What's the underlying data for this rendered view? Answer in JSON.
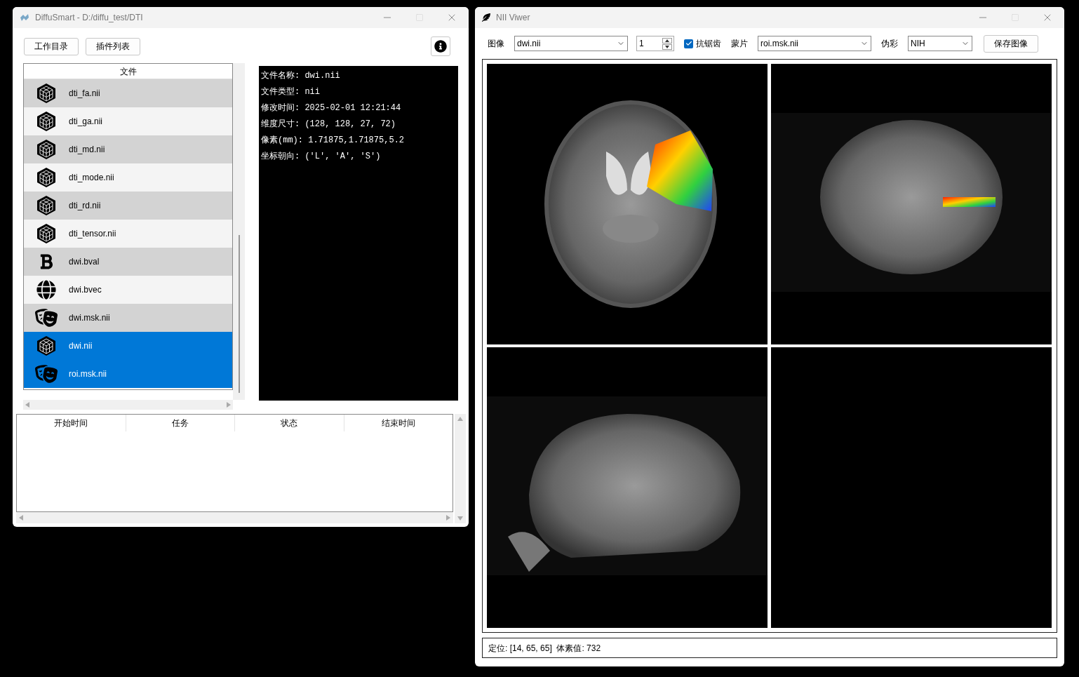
{
  "main_window": {
    "title": "DiffuSmart - D:/diffu_test/DTI",
    "toolbar_buttons": [
      "工作目录",
      "插件列表"
    ],
    "file_list": {
      "header": "文件",
      "items": [
        {
          "name": "dti_fa.nii",
          "kind": "volume",
          "selected": false
        },
        {
          "name": "dti_ga.nii",
          "kind": "volume",
          "selected": false
        },
        {
          "name": "dti_md.nii",
          "kind": "volume",
          "selected": false
        },
        {
          "name": "dti_mode.nii",
          "kind": "volume",
          "selected": false
        },
        {
          "name": "dti_rd.nii",
          "kind": "volume",
          "selected": false
        },
        {
          "name": "dti_tensor.nii",
          "kind": "volume",
          "selected": false
        },
        {
          "name": "dwi.bval",
          "kind": "bval",
          "selected": false
        },
        {
          "name": "dwi.bvec",
          "kind": "bvec",
          "selected": false
        },
        {
          "name": "dwi.msk.nii",
          "kind": "mask",
          "selected": false
        },
        {
          "name": "dwi.nii",
          "kind": "volume",
          "selected": true
        },
        {
          "name": "roi.msk.nii",
          "kind": "mask",
          "selected": true
        }
      ]
    },
    "info_lines": [
      "文件名称: dwi.nii",
      "文件类型: nii",
      "修改时间: 2025-02-01 12:21:44",
      "维度尺寸: (128, 128, 27, 72)",
      "像素(mm): 1.71875,1.71875,5.2",
      "坐标朝向: ('L', 'A', 'S')"
    ],
    "task_table": {
      "columns": [
        "开始时间",
        "任务",
        "状态",
        "结束时间"
      ]
    }
  },
  "viewer_window": {
    "title": "NII Viwer",
    "toolbar": {
      "image_label": "图像",
      "image_value": "dwi.nii",
      "slice_value": "1",
      "antialias": {
        "label": "抗锯齿",
        "checked": true
      },
      "mask_label": "蒙片",
      "mask_value": "roi.msk.nii",
      "colormap_label": "伪彩",
      "colormap_value": "NIH",
      "save_button": "保存图像"
    },
    "views": [
      {
        "kind": "axial"
      },
      {
        "kind": "coronal"
      },
      {
        "kind": "sagittal"
      },
      {
        "kind": "empty"
      }
    ],
    "status": "定位: [14, 65, 65]  体素值: 732"
  }
}
